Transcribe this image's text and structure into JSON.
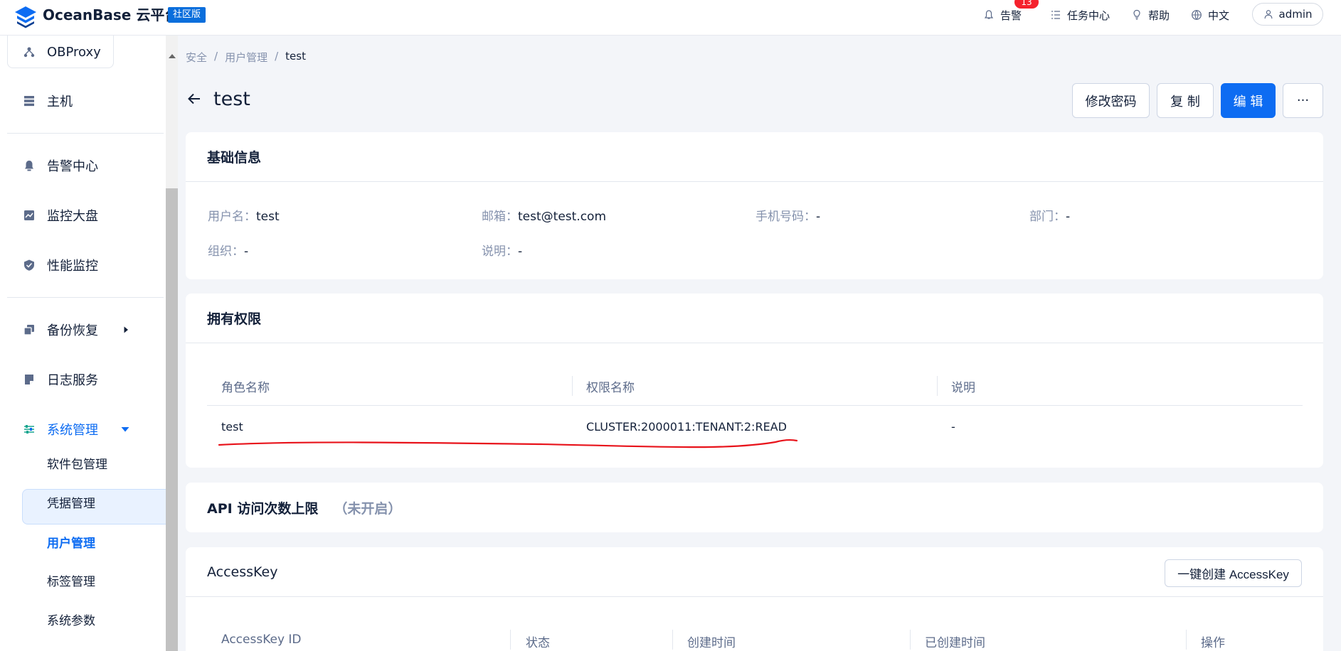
{
  "topbar": {
    "brand": "OceanBase 云平台",
    "badge": "社区版",
    "alert_label": "告警",
    "alert_count": "13",
    "tasks_label": "任务中心",
    "help_label": "帮助",
    "language_label": "中文",
    "user_label": "admin"
  },
  "sidebar": {
    "items": [
      {
        "label": "OBProxy",
        "icon": "proxy-icon"
      },
      {
        "label": "主机",
        "icon": "host-icon"
      },
      {
        "label": "告警中心",
        "icon": "bell-icon"
      },
      {
        "label": "监控大盘",
        "icon": "chart-icon"
      },
      {
        "label": "性能监控",
        "icon": "shield-icon"
      },
      {
        "label": "备份恢复",
        "icon": "backup-icon"
      },
      {
        "label": "日志服务",
        "icon": "log-icon"
      },
      {
        "label": "系统管理",
        "icon": "settings-icon"
      }
    ],
    "sub_items": [
      "软件包管理",
      "凭据管理",
      "用户管理",
      "标签管理",
      "系统参数"
    ],
    "active_color": "#0d6cf2"
  },
  "breadcrumb": [
    "安全",
    "用户管理",
    "test"
  ],
  "breadcrumb_sep": "/",
  "page": {
    "title": "test",
    "buttons": {
      "change_password": "修改密码",
      "copy": "复 制",
      "edit": "编 辑",
      "more": "···"
    }
  },
  "basic_info": {
    "title": "基础信息",
    "fields": {
      "username": {
        "label": "用户名：",
        "value": "test"
      },
      "email": {
        "label": "邮箱：",
        "value": "test@test.com"
      },
      "phone": {
        "label": "手机号码：",
        "value": "-"
      },
      "department": {
        "label": "部门：",
        "value": "-"
      },
      "organization": {
        "label": "组织：",
        "value": "-"
      },
      "description": {
        "label": "说明：",
        "value": "-"
      }
    }
  },
  "permissions": {
    "title": "拥有权限",
    "columns": [
      "角色名称",
      "权限名称",
      "说明"
    ],
    "rows": [
      {
        "role": "test",
        "permission": "CLUSTER:2000011:TENANT:2:READ",
        "description": "-"
      }
    ]
  },
  "api_limit": {
    "title": "API 访问次数上限",
    "status": "（未开启）"
  },
  "accesskey": {
    "title": "AccessKey",
    "create_button": "一键创建 AccessKey",
    "columns": [
      "AccessKey ID",
      "状态",
      "创建时间",
      "已创建时间",
      "操作"
    ]
  },
  "colors": {
    "primary": "#0d6cf2",
    "annotation": "#e8131b",
    "alert_badge": "#f5222d"
  }
}
